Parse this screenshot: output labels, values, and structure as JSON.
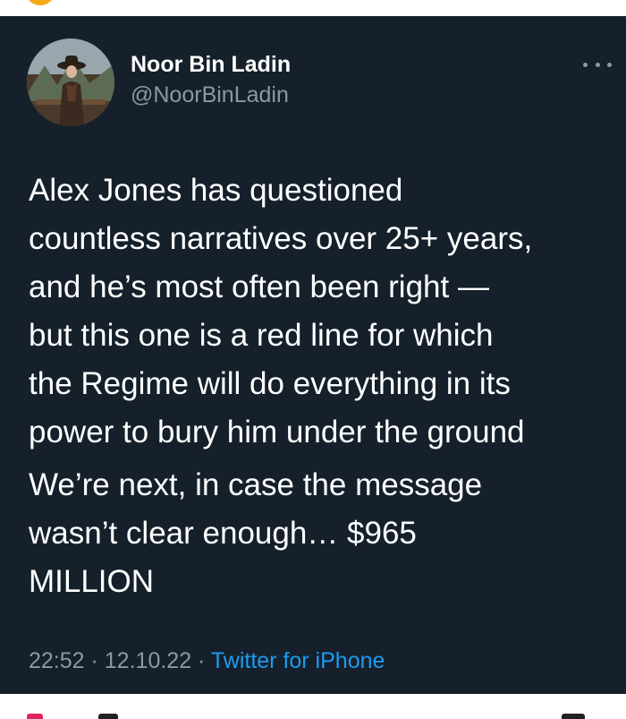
{
  "tweet": {
    "author": {
      "display_name": "Noor Bin Ladin",
      "handle": "@NoorBinLadin"
    },
    "text_lines_1": [
      "Alex Jones has questioned",
      "countless narratives over 25+ years,",
      "and he’s most often been right —",
      "but this one is a red line for which",
      "the Regime will do everything in its",
      "power to bury him under the ground"
    ],
    "text_lines_2": [
      "We’re next, in case the message",
      "wasn’t clear enough… $965",
      "MILLION"
    ],
    "time": "22:52",
    "separator": " · ",
    "date": "12.10.22",
    "source": "Twitter for iPhone"
  },
  "icons": {
    "more": "more-horizontal-icon",
    "avatar": "profile-photo"
  },
  "colors": {
    "background": "#15202b",
    "text": "#ffffff",
    "secondary": "#8b98a5",
    "link": "#1d9bf0"
  }
}
